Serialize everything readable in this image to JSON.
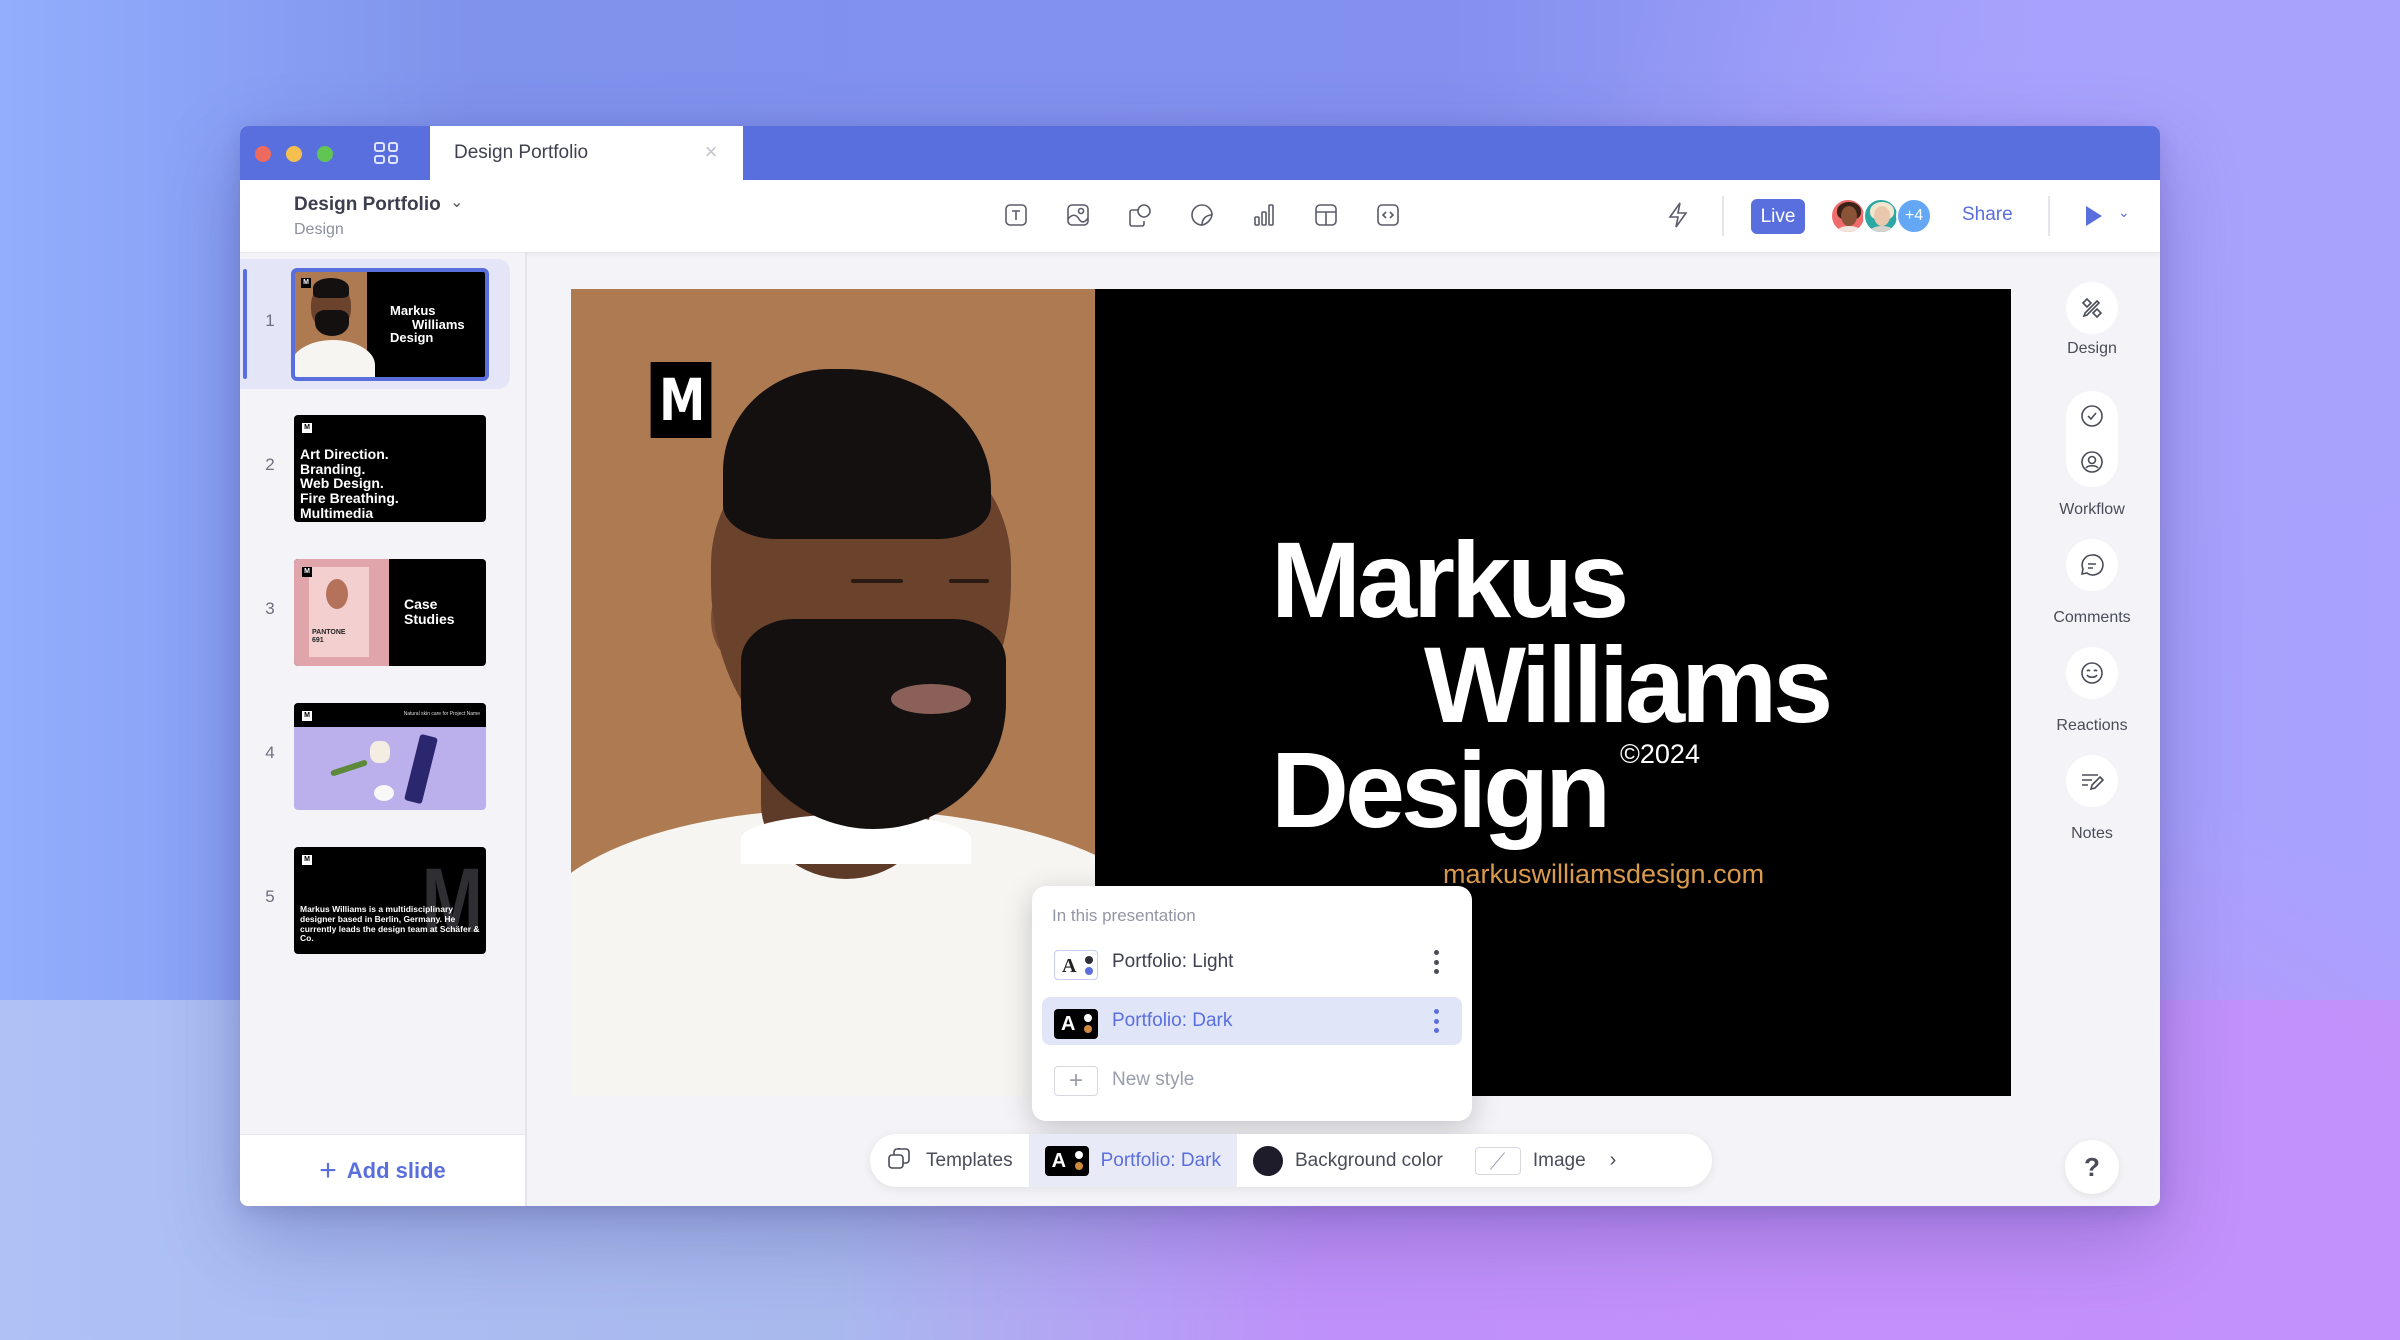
{
  "window": {
    "tab_title": "Design Portfolio",
    "close_icon": "×"
  },
  "header": {
    "doc_title": "Design Portfolio",
    "doc_subtitle": "Design",
    "toolbar_tools": [
      "text-icon",
      "image-icon",
      "shapes-icon",
      "sticker-icon",
      "chart-icon",
      "table-icon",
      "embed-icon"
    ],
    "live_label": "Live",
    "collaborators_more": "+4",
    "share_label": "Share"
  },
  "sidebar": {
    "slides": [
      {
        "number": "1",
        "title_lines": [
          "Markus",
          "Williams",
          "Design"
        ],
        "selected": true
      },
      {
        "number": "2",
        "lines": [
          "Art Direction.",
          "Branding.",
          "Web Design.",
          "Fire Breathing.",
          "Multimedia"
        ]
      },
      {
        "number": "3",
        "lines": [
          "Case",
          "Studies"
        ],
        "caption": [
          "PANTONE",
          "691"
        ]
      },
      {
        "number": "4",
        "header_text": "Natural skin care for Project Name"
      },
      {
        "number": "5",
        "body": "Markus Williams is a multidisciplinary designer based in Berlin, Germany. He currently leads the design team at Schäfer & Co."
      }
    ],
    "add_slide_label": "Add slide"
  },
  "slide": {
    "logo_letter": "M",
    "title_line1": "Markus",
    "title_line2": "Williams",
    "title_line3": "Design",
    "copyright": "©2024",
    "url": "markuswilliamsdesign.com"
  },
  "style_popup": {
    "heading": "In this presentation",
    "items": [
      {
        "label": "Portfolio: Light",
        "swatch_letter": "A",
        "dot_colors": [
          "#2f2f3a",
          "#5a6fde"
        ],
        "selected": false
      },
      {
        "label": "Portfolio: Dark",
        "swatch_letter": "A",
        "dot_colors": [
          "#ffffff",
          "#d08a3c"
        ],
        "selected": true
      }
    ],
    "new_style_label": "New style"
  },
  "bottom_toolbar": {
    "templates_label": "Templates",
    "style_label": "Portfolio: Dark",
    "style_swatch_letter": "A",
    "background_label": "Background color",
    "background_color": "#1e1c2a",
    "image_label": "Image",
    "more_icon": "›"
  },
  "right_rail": {
    "design_label": "Design",
    "workflow_label": "Workflow",
    "comments_label": "Comments",
    "reactions_label": "Reactions",
    "notes_label": "Notes",
    "help_label": "?"
  },
  "colors": {
    "accent": "#5a6fde",
    "url_orange": "#d99a4e",
    "photo_bg": "#ad7a52"
  }
}
